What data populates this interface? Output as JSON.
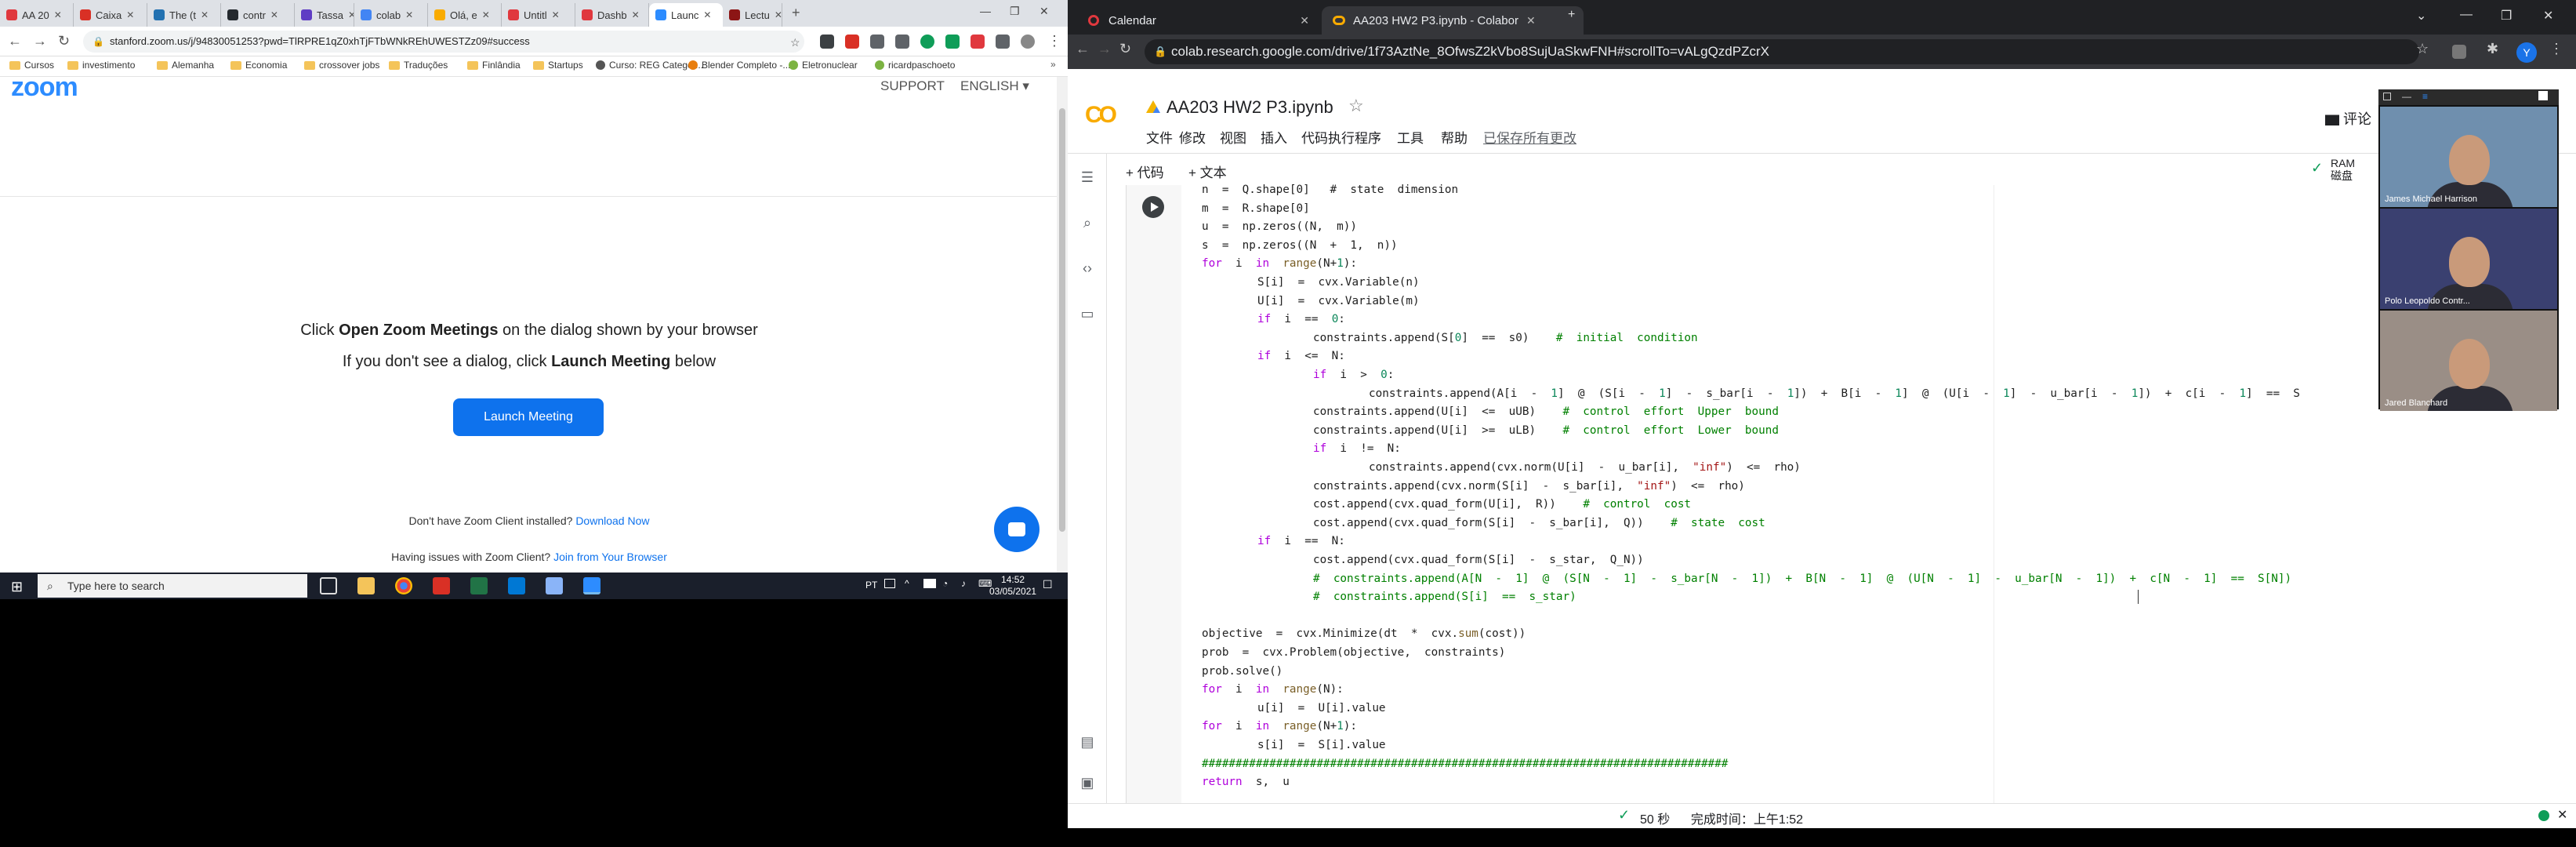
{
  "left_browser": {
    "tabs": [
      {
        "label": "AA 20",
        "color": "#e0383e"
      },
      {
        "label": "Caixa",
        "color": "#d93025"
      },
      {
        "label": "The (t",
        "color": "#2271b1"
      },
      {
        "label": "contr",
        "color": "#24292e"
      },
      {
        "label": "Tassa",
        "color": "#5f3dc4"
      },
      {
        "label": "colab",
        "color": "#4285f4"
      },
      {
        "label": "Olá, e",
        "color": "#f9ab00"
      },
      {
        "label": "Untitl",
        "color": "#e0383e"
      },
      {
        "label": "Dashb",
        "color": "#e0383e"
      },
      {
        "label": "Launc",
        "color": "#2d8cff"
      },
      {
        "label": "Lectu",
        "color": "#8c1515"
      }
    ],
    "close_glyph": "✕",
    "new_tab": "+",
    "url": "stanford.zoom.us/j/94830051253?pwd=TlRPRE1qZ0xhTjFTbWNkREhUWESTZz09#success",
    "bookmarks": [
      "Cursos",
      "investimento",
      "Alemanha",
      "Economia",
      "crossover jobs",
      "Traduções",
      "Finlândia",
      "Startups",
      "Curso: REG Categor...",
      "Blender Completo -...",
      "Eletronuclear",
      "ricardpaschoeto"
    ]
  },
  "zoom": {
    "logo": "zoom",
    "support": "SUPPORT",
    "language": "ENGLISH ▾",
    "msg1_pre": "Click ",
    "msg1_bold": "Open Zoom Meetings",
    "msg1_post": " on the dialog shown by your browser",
    "msg2_pre": "If you don't see a dialog, click ",
    "msg2_bold": "Launch Meeting",
    "msg2_post": " below",
    "launch_button": "Launch Meeting",
    "client_q": "Don't have Zoom Client installed? ",
    "client_link": "Download Now",
    "issues_q": "Having issues with Zoom Client? ",
    "issues_link": "Join from Your Browser"
  },
  "taskbar": {
    "search_placeholder": "Type here to search",
    "lang": "PT",
    "time": "14:52",
    "date": "03/05/2021"
  },
  "right_browser": {
    "tabs": [
      {
        "label": "Calendar"
      },
      {
        "label": "AA203 HW2 P3.ipynb - Colabor"
      }
    ],
    "url": "colab.research.google.com/drive/1f73AztNe_8OfwsZ2kVbo8SujUaSkwFNH#scrollTo=vALgQzdPZcrX",
    "profile_initial": "Y"
  },
  "colab": {
    "logo": "CO",
    "notebook_title": "AA203 HW2 P3.ipynb",
    "menu": [
      "文件",
      "修改",
      "视图",
      "插入",
      "代码执行程序",
      "工具",
      "帮助"
    ],
    "saved_status": "已保存所有更改",
    "comments": "评论",
    "add_code": "+ 代码",
    "add_text": "+ 文本",
    "ram_label": "RAM",
    "disk_label": "磁盘",
    "status_time": "50 秒",
    "status_done": "完成时间：上午1:52"
  },
  "code_lines": [
    {
      "indent": 0,
      "html": "n  =  Q.shape[0]   #  state  dimension"
    },
    {
      "indent": 0,
      "html": "m  =  R.shape[0]"
    },
    {
      "indent": 0,
      "html": "u  =  np.zeros((N,  m))"
    },
    {
      "indent": 0,
      "html": "s  =  np.zeros((N  +  1,  n))"
    },
    {
      "indent": 0,
      "html": "<span class=kw>for</span>  i  <span class=kw>in</span>  <span class=fn>range</span>(N+<span class=num>1</span>):"
    },
    {
      "indent": 1,
      "html": "S[i]  =  cvx.Variable(n)"
    },
    {
      "indent": 1,
      "html": "U[i]  =  cvx.Variable(m)"
    },
    {
      "indent": 1,
      "html": "<span class=kw>if</span>  i  ==  <span class=num>0</span>:"
    },
    {
      "indent": 2,
      "html": "constraints.append(S[<span class=num>0</span>]  ==  s0)    <span class=cm>#  initial  condition</span>"
    },
    {
      "indent": 1,
      "html": "<span class=kw>if</span>  i  &lt;=  N:"
    },
    {
      "indent": 2,
      "html": "<span class=kw>if</span>  i  &gt;  <span class=num>0</span>:"
    },
    {
      "indent": 3,
      "html": "constraints.append(A[i  -  <span class=num>1</span>]  @  (S[i  -  <span class=num>1</span>]  -  s_bar[i  -  <span class=num>1</span>])  +  B[i  -  <span class=num>1</span>]  @  (U[i  -  <span class=num>1</span>]  -  u_bar[i  -  <span class=num>1</span>])  +  c[i  -  <span class=num>1</span>]  ==  S"
    },
    {
      "indent": 2,
      "html": "constraints.append(U[i]  &lt;=  uUB)    <span class=cm>#  control  effort  Upper  bound</span>"
    },
    {
      "indent": 2,
      "html": "constraints.append(U[i]  &gt;=  uLB)    <span class=cm>#  control  effort  Lower  bound</span>"
    },
    {
      "indent": 2,
      "html": "<span class=kw>if</span>  i  !=  N:"
    },
    {
      "indent": 3,
      "html": "constraints.append(cvx.norm(U[i]  -  u_bar[i],  <span class=str>\"inf\"</span>)  &lt;=  rho)"
    },
    {
      "indent": 2,
      "html": "constraints.append(cvx.norm(S[i]  -  s_bar[i],  <span class=str>\"inf\"</span>)  &lt;=  rho)"
    },
    {
      "indent": 2,
      "html": "cost.append(cvx.quad_form(U[i],  R))    <span class=cm>#  control  cost</span>"
    },
    {
      "indent": 2,
      "html": "cost.append(cvx.quad_form(S[i]  -  s_bar[i],  Q))    <span class=cm>#  state  cost</span>"
    },
    {
      "indent": 1,
      "html": "<span class=kw>if</span>  i  ==  N:"
    },
    {
      "indent": 2,
      "html": "cost.append(cvx.quad_form(S[i]  -  s_star,  Q_N))"
    },
    {
      "indent": 2,
      "html": "<span class=cm>#  constraints.append(A[N  -  1]  @  (S[N  -  1]  -  s_bar[N  -  1])  +  B[N  -  1]  @  (U[N  -  1]  -  u_bar[N  -  1])  +  c[N  -  1]  ==  S[N])</span>"
    },
    {
      "indent": 2,
      "html": "<span class=cm>#  constraints.append(S[i]  ==  s_star)</span>"
    },
    {
      "indent": 0,
      "html": ""
    },
    {
      "indent": 0,
      "html": "objective  =  cvx.Minimize(dt  *  cvx.<span class=fn>sum</span>(cost))"
    },
    {
      "indent": 0,
      "html": "prob  =  cvx.Problem(objective,  constraints)"
    },
    {
      "indent": 0,
      "html": "prob.solve()"
    },
    {
      "indent": 0,
      "html": "<span class=kw>for</span>  i  <span class=kw>in</span>  <span class=fn>range</span>(N):"
    },
    {
      "indent": 1,
      "html": "u[i]  =  U[i].value"
    },
    {
      "indent": 0,
      "html": "<span class=kw>for</span>  i  <span class=kw>in</span>  <span class=fn>range</span>(N+<span class=num>1</span>):"
    },
    {
      "indent": 1,
      "html": "s[i]  =  S[i].value"
    },
    {
      "indent": 0,
      "html": "<span class=cm>##############################################################################</span>"
    },
    {
      "indent": 0,
      "html": "<span class=kw>return</span>  s,  u"
    }
  ],
  "video_participants": [
    {
      "name": "James Michael Harrison",
      "bg": "#6f8fae"
    },
    {
      "name": "Polo Leopoldo Contr...",
      "bg": "#3a4070"
    },
    {
      "name": "Jared Blanchard",
      "bg": "#9a8e86"
    }
  ]
}
